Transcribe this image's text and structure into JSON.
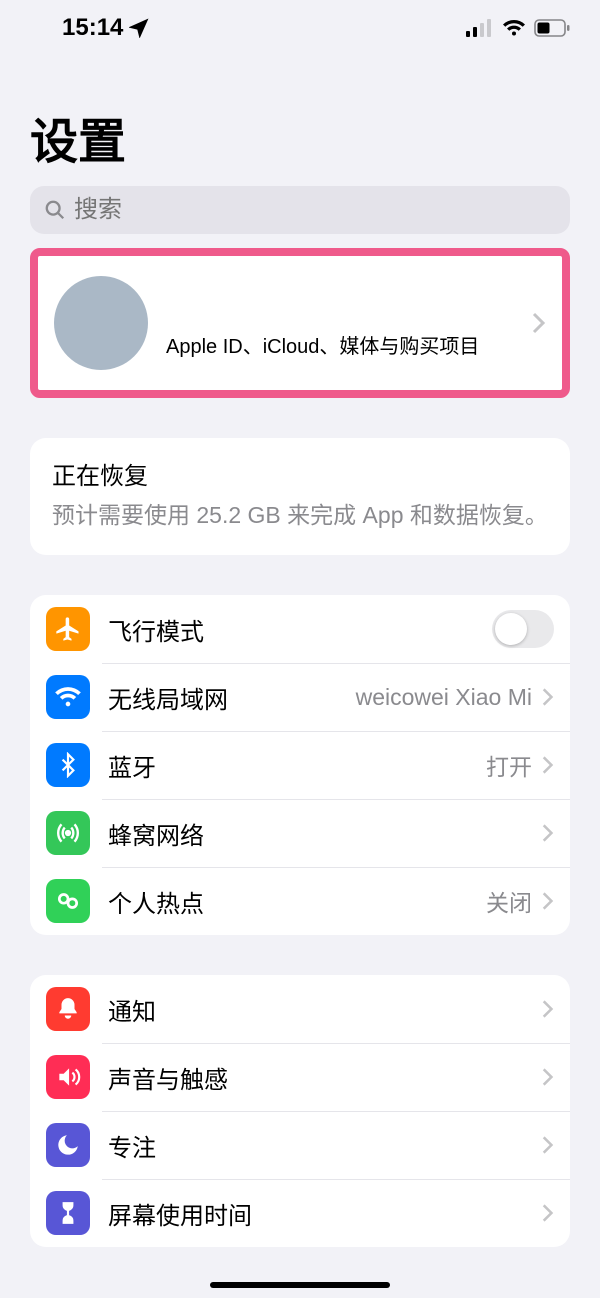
{
  "status": {
    "time": "15:14"
  },
  "page_title": "设置",
  "search": {
    "placeholder": "搜索"
  },
  "apple_id": {
    "subtitle": "Apple ID、iCloud、媒体与购买项目"
  },
  "restore": {
    "title": "正在恢复",
    "subtitle": "预计需要使用 25.2 GB 来完成 App 和数据恢复。"
  },
  "group1": {
    "airplane": {
      "label": "飞行模式"
    },
    "wifi": {
      "label": "无线局域网",
      "value": "weicowei Xiao Mi"
    },
    "bluetooth": {
      "label": "蓝牙",
      "value": "打开"
    },
    "cellular": {
      "label": "蜂窝网络"
    },
    "hotspot": {
      "label": "个人热点",
      "value": "关闭"
    }
  },
  "group2": {
    "notifications": {
      "label": "通知"
    },
    "sound": {
      "label": "声音与触感"
    },
    "focus": {
      "label": "专注"
    },
    "screentime": {
      "label": "屏幕使用时间"
    }
  }
}
